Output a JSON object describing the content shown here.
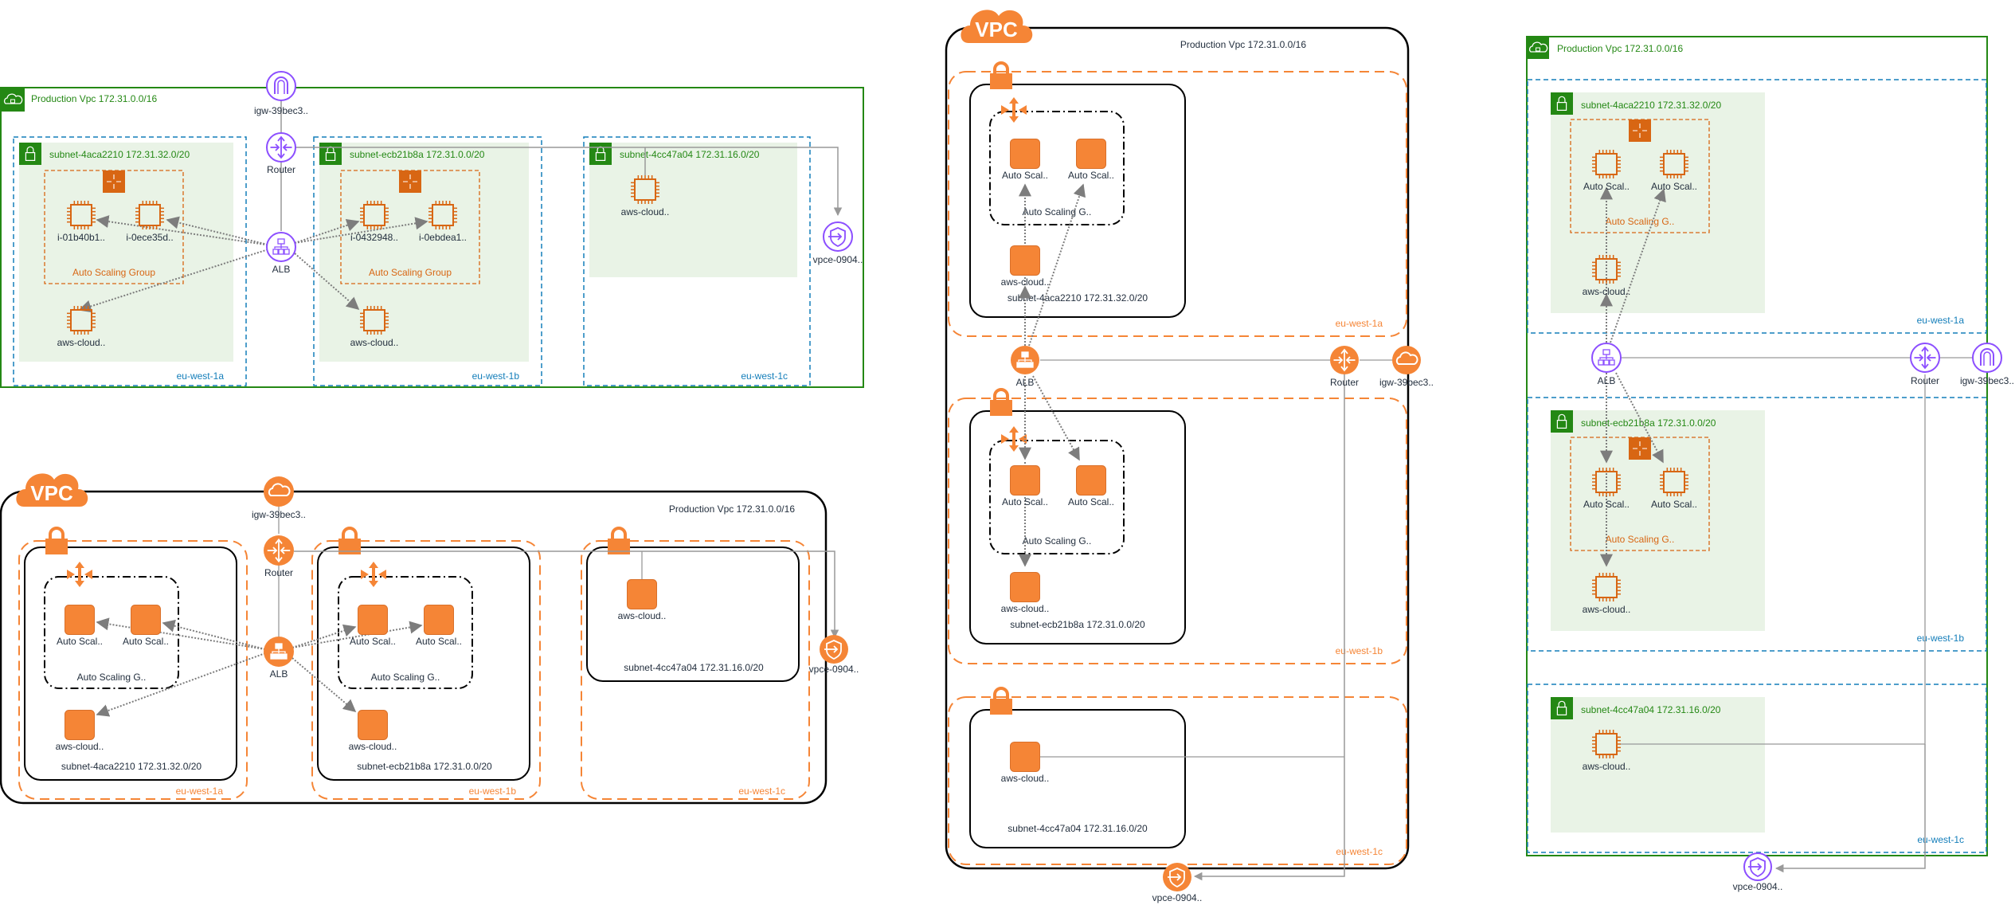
{
  "colors": {
    "aws_green": "#248814",
    "az_blue": "#147eba",
    "subnet_fill": "#e9f3e6",
    "ec2_orange": "#d86613",
    "simple_orange": "#f58536",
    "network_purple": "#8c4fff",
    "edge_gray": "#999999",
    "arrow_gray": "#7d7d7d",
    "black": "#000000"
  },
  "diagrams": [
    {
      "id": "d1",
      "style": "aws2019-horizontal",
      "vpc_label": "Production Vpc 172.31.0.0/16",
      "igw_label": "igw-39bec3..",
      "router_label": "Router",
      "alb_label": "ALB",
      "vpce_label": "vpce-0904..",
      "zones": [
        {
          "label": "eu-west-1a",
          "subnet_label": "subnet-4aca2210 172.31.32.0/20",
          "asg_label": "Auto Scaling Group",
          "instances": [
            "i-01b40b1..",
            "i-0ece35d.."
          ],
          "standalone": "aws-cloud.."
        },
        {
          "label": "eu-west-1b",
          "subnet_label": "subnet-ecb21b8a 172.31.0.0/20",
          "asg_label": "Auto Scaling Group",
          "instances": [
            "i-0432948..",
            "i-0ebdea1.."
          ],
          "standalone": "aws-cloud.."
        },
        {
          "label": "eu-west-1c",
          "subnet_label": "subnet-4cc47a04 172.31.16.0/20",
          "standalone": "aws-cloud.."
        }
      ]
    },
    {
      "id": "d2",
      "style": "aws-simple-horizontal",
      "vpc_badge": "VPC",
      "vpc_label": "Production Vpc 172.31.0.0/16",
      "igw_label": "igw-39bec3..",
      "router_label": "Router",
      "alb_label": "ALB",
      "vpce_label": "vpce-0904..",
      "zones": [
        {
          "label": "eu-west-1a",
          "subnet_label": "subnet-4aca2210 172.31.32.0/20",
          "asg_label": "Auto Scaling G..",
          "instances": [
            "Auto Scal..",
            "Auto Scal.."
          ],
          "standalone": "aws-cloud.."
        },
        {
          "label": "eu-west-1b",
          "subnet_label": "subnet-ecb21b8a 172.31.0.0/20",
          "asg_label": "Auto Scaling G..",
          "instances": [
            "Auto Scal..",
            "Auto Scal.."
          ],
          "standalone": "aws-cloud.."
        },
        {
          "label": "eu-west-1c",
          "subnet_label": "subnet-4cc47a04 172.31.16.0/20",
          "standalone": "aws-cloud.."
        }
      ]
    },
    {
      "id": "d3",
      "style": "aws-simple-vertical",
      "vpc_badge": "VPC",
      "vpc_label": "Production Vpc 172.31.0.0/16",
      "igw_label": "igw-39bec3..",
      "router_label": "Router",
      "alb_label": "ALB",
      "vpce_label": "vpce-0904..",
      "zones": [
        {
          "label": "eu-west-1a",
          "subnet_label": "subnet-4aca2210 172.31.32.0/20",
          "asg_label": "Auto Scaling G..",
          "instances": [
            "Auto Scal..",
            "Auto Scal.."
          ],
          "standalone": "aws-cloud.."
        },
        {
          "label": "eu-west-1b",
          "subnet_label": "subnet-ecb21b8a 172.31.0.0/20",
          "asg_label": "Auto Scaling G..",
          "instances": [
            "Auto Scal..",
            "Auto Scal.."
          ],
          "standalone": "aws-cloud.."
        },
        {
          "label": "eu-west-1c",
          "subnet_label": "subnet-4cc47a04 172.31.16.0/20",
          "standalone": "aws-cloud.."
        }
      ]
    },
    {
      "id": "d4",
      "style": "aws2019-vertical",
      "vpc_label": "Production Vpc 172.31.0.0/16",
      "igw_label": "igw-39bec3..",
      "router_label": "Router",
      "alb_label": "ALB",
      "vpce_label": "vpce-0904..",
      "zones": [
        {
          "label": "eu-west-1a",
          "subnet_label": "subnet-4aca2210 172.31.32.0/20",
          "asg_label": "Auto Scaling G..",
          "instances": [
            "Auto Scal..",
            "Auto Scal.."
          ],
          "standalone": "aws-cloud.."
        },
        {
          "label": "eu-west-1b",
          "subnet_label": "subnet-ecb21b8a 172.31.0.0/20",
          "asg_label": "Auto Scaling G..",
          "instances": [
            "Auto Scal..",
            "Auto Scal.."
          ],
          "standalone": "aws-cloud.."
        },
        {
          "label": "eu-west-1c",
          "subnet_label": "subnet-4cc47a04 172.31.16.0/20",
          "standalone": "aws-cloud.."
        }
      ]
    }
  ]
}
